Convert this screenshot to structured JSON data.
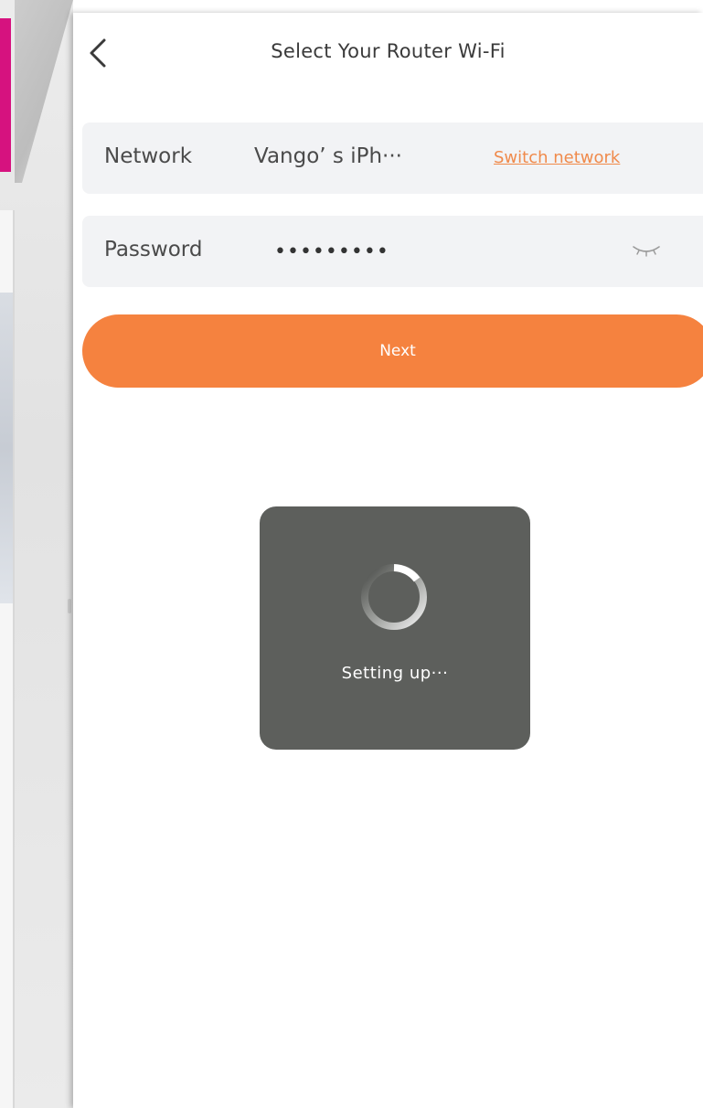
{
  "header": {
    "title": "Select Your Router Wi-Fi"
  },
  "network": {
    "label": "Network",
    "value": "Vango’ s iPh···",
    "switch_label": "Switch network"
  },
  "password": {
    "label": "Password",
    "value": "•••••••••"
  },
  "next_label": "Next",
  "loading": {
    "text": "Setting up···"
  },
  "colors": {
    "accent": "#f5823f",
    "field_bg": "#f2f3f5",
    "overlay_bg": "#5d5f5c"
  },
  "icons": {
    "back": "chevron-left-icon",
    "password_toggle": "eye-closed-icon",
    "loading": "spinner-icon"
  }
}
